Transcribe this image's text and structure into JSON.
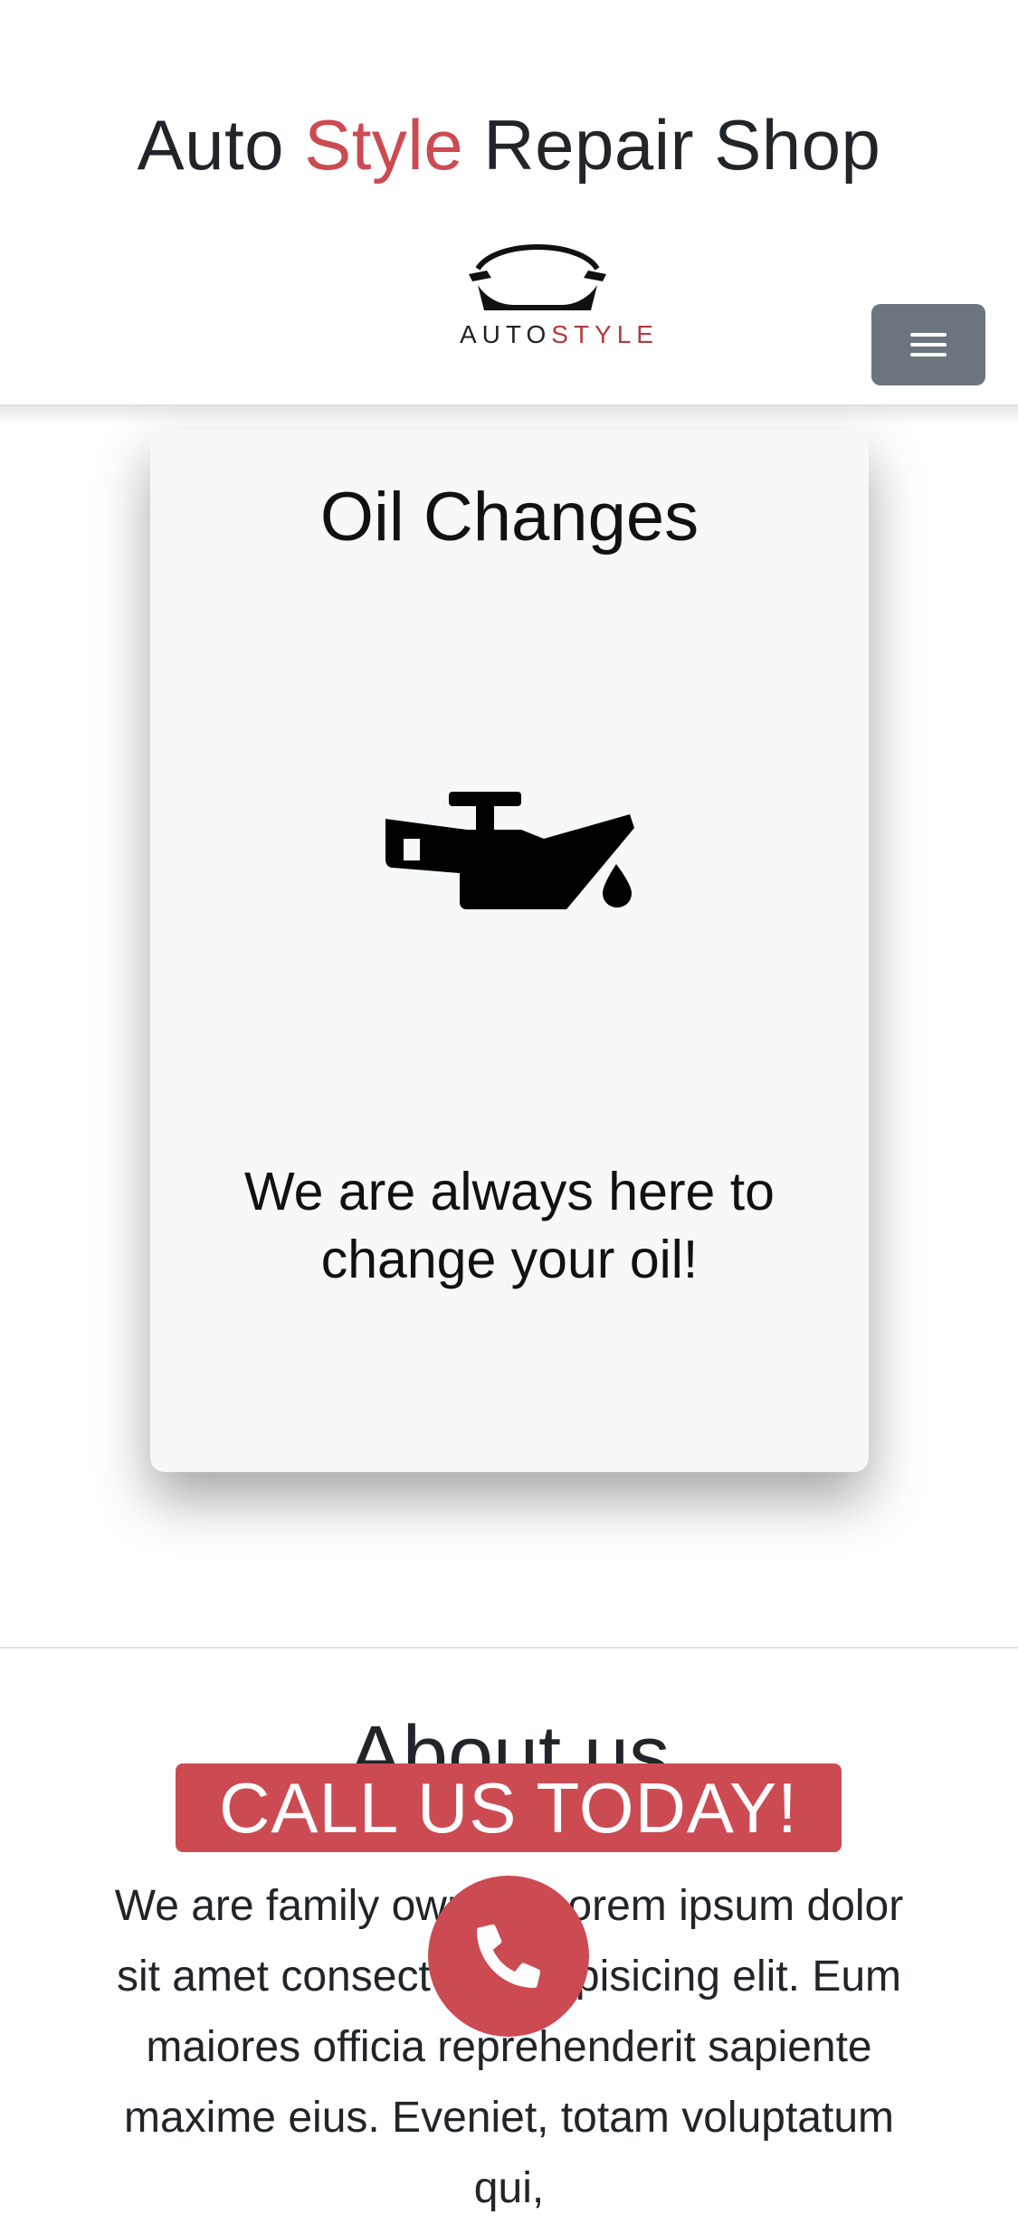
{
  "header": {
    "title_part1": "Auto ",
    "title_accent": "Style",
    "title_part2": " Repair Shop",
    "logo_text_left": "AUTO",
    "logo_text_right": "STYLE",
    "menu_icon": "hamburger-icon"
  },
  "card": {
    "title": "Oil Changes",
    "icon": "oil-can-icon",
    "text": "We are always here to change your oil!"
  },
  "about": {
    "title": "About us",
    "text": "We are family owned. Lorem ipsum dolor sit amet consectetur adipisicing elit. Eum maiores officia reprehenderit sapiente maxime eius. Eveniet, totam voluptatum qui,"
  },
  "cta": {
    "label": "CALL US TODAY!",
    "call_icon": "phone-icon"
  },
  "colors": {
    "accent": "#cc4a52",
    "menu_button": "#6c757d",
    "card_background": "#f7f8fa"
  }
}
